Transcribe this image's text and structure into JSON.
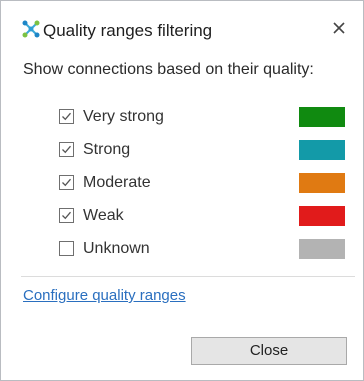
{
  "window": {
    "title": "Quality ranges filtering",
    "app_icon": "network-nodes-icon",
    "close_icon": "close-icon"
  },
  "prompt": "Show connections based on their quality:",
  "options": [
    {
      "label": "Very strong",
      "checked": true,
      "color": "#108a10"
    },
    {
      "label": "Strong",
      "checked": true,
      "color": "#139aa8"
    },
    {
      "label": "Moderate",
      "checked": true,
      "color": "#e07a12"
    },
    {
      "label": "Weak",
      "checked": true,
      "color": "#e11b1b"
    },
    {
      "label": "Unknown",
      "checked": false,
      "color": "#b3b3b3"
    }
  ],
  "configure_link": "Configure quality ranges",
  "close_button": "Close"
}
